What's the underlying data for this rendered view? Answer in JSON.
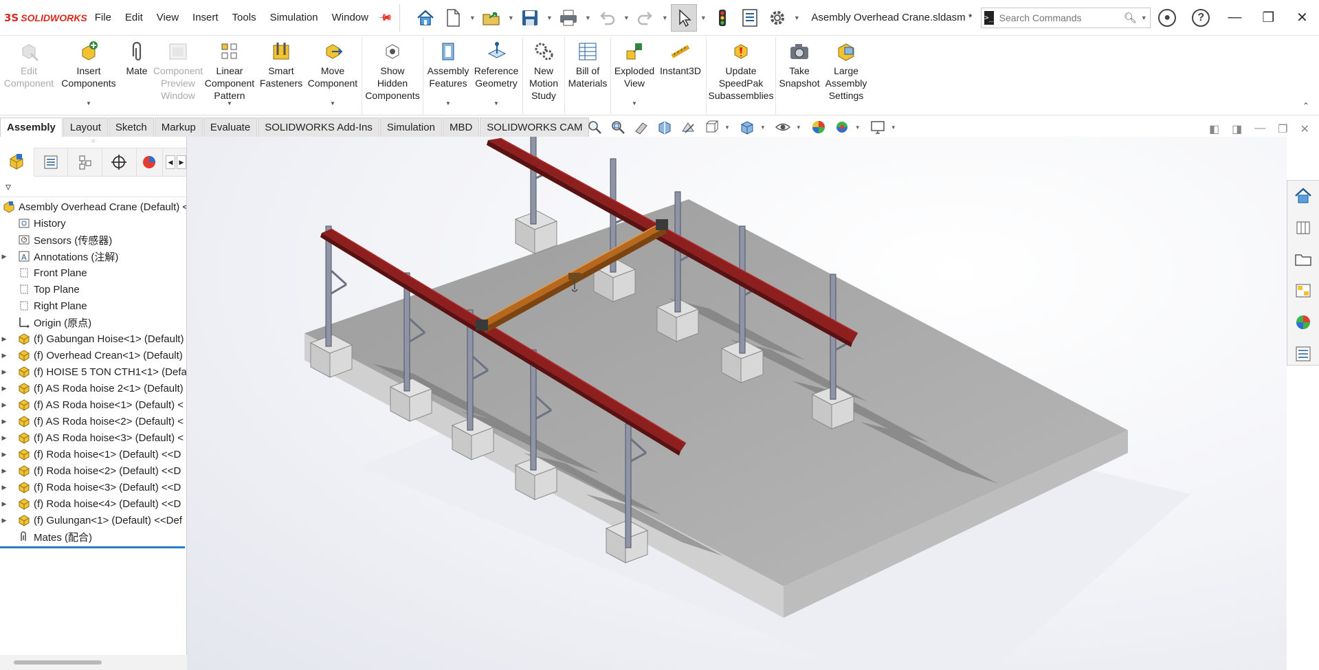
{
  "app": {
    "logo_ds": "3S",
    "logo_name": "SOLIDWORKS",
    "brand_color": "#d52b1e"
  },
  "menu": [
    "File",
    "Edit",
    "View",
    "Insert",
    "Tools",
    "Simulation",
    "Window"
  ],
  "document_title": "Asembly Overhead Crane.sldasm *",
  "search": {
    "placeholder": "Search Commands"
  },
  "ribbon": {
    "edit_component": [
      "Edit",
      "Component"
    ],
    "insert_components": [
      "Insert",
      "Components"
    ],
    "mate": [
      "Mate"
    ],
    "component_preview": [
      "Component",
      "Preview",
      "Window"
    ],
    "linear_pattern": [
      "Linear",
      "Component",
      "Pattern"
    ],
    "smart_fasteners": [
      "Smart",
      "Fasteners"
    ],
    "move_component": [
      "Move",
      "Component"
    ],
    "show_hidden": [
      "Show",
      "Hidden",
      "Components"
    ],
    "assembly_features": [
      "Assembly",
      "Features"
    ],
    "reference_geometry": [
      "Reference",
      "Geometry"
    ],
    "new_motion_study": [
      "New",
      "Motion",
      "Study"
    ],
    "bill_of_materials": [
      "Bill of",
      "Materials"
    ],
    "exploded_view": [
      "Exploded",
      "View"
    ],
    "instant3d": [
      "Instant3D"
    ],
    "update_speedpak": [
      "Update",
      "SpeedPak",
      "Subassemblies"
    ],
    "take_snapshot": [
      "Take",
      "Snapshot"
    ],
    "large_assembly": [
      "Large",
      "Assembly",
      "Settings"
    ]
  },
  "tabs": [
    "Assembly",
    "Layout",
    "Sketch",
    "Markup",
    "Evaluate",
    "SOLIDWORKS Add-Ins",
    "Simulation",
    "MBD",
    "SOLIDWORKS CAM"
  ],
  "active_tab": "Assembly",
  "tree": {
    "root": "Asembly Overhead Crane (Default) <",
    "items": [
      {
        "label": "History",
        "icon": "history-icon",
        "expandable": false
      },
      {
        "label": "Sensors (传感器)",
        "icon": "sensors-icon",
        "expandable": false
      },
      {
        "label": "Annotations (注解)",
        "icon": "annotations-icon",
        "expandable": true
      },
      {
        "label": "Front Plane",
        "icon": "plane-icon",
        "expandable": false
      },
      {
        "label": "Top Plane",
        "icon": "plane-icon",
        "expandable": false
      },
      {
        "label": "Right Plane",
        "icon": "plane-icon",
        "expandable": false
      },
      {
        "label": "Origin (原点)",
        "icon": "origin-icon",
        "expandable": false
      },
      {
        "label": "(f) Gabungan Hoise<1> (Default)",
        "icon": "subassembly-icon",
        "expandable": true
      },
      {
        "label": "(f) Overhead Crean<1> (Default)",
        "icon": "subassembly-icon",
        "expandable": true
      },
      {
        "label": "(f) HOISE 5 TON CTH1<1> (Defau",
        "icon": "subassembly-icon",
        "expandable": true
      },
      {
        "label": "(f) AS Roda hoise 2<1> (Default)",
        "icon": "subassembly-icon",
        "expandable": true
      },
      {
        "label": "(f) AS Roda hoise<1> (Default) <",
        "icon": "subassembly-icon",
        "expandable": true
      },
      {
        "label": "(f) AS Roda hoise<2> (Default) <",
        "icon": "subassembly-icon",
        "expandable": true
      },
      {
        "label": "(f) AS Roda hoise<3> (Default) <",
        "icon": "subassembly-icon",
        "expandable": true
      },
      {
        "label": "(f) Roda hoise<1> (Default) <<D",
        "icon": "subassembly-icon",
        "expandable": true
      },
      {
        "label": "(f) Roda hoise<2> (Default) <<D",
        "icon": "subassembly-icon",
        "expandable": true
      },
      {
        "label": "(f) Roda hoise<3> (Default) <<D",
        "icon": "subassembly-icon",
        "expandable": true
      },
      {
        "label": "(f) Roda hoise<4> (Default) <<D",
        "icon": "subassembly-icon",
        "expandable": true
      },
      {
        "label": "(f) Gulungan<1> (Default) <<Def",
        "icon": "subassembly-icon",
        "expandable": true
      },
      {
        "label": "Mates (配合)",
        "icon": "mates-icon",
        "expandable": false
      }
    ]
  },
  "colors": {
    "runway_beam": "#8e1f1f",
    "bridge_girder": "#b5681e",
    "column": "#8f95a6",
    "slab": "#b3b3b3",
    "footing": "#d4d4d4",
    "selection_blue": "#2a7ac5"
  }
}
